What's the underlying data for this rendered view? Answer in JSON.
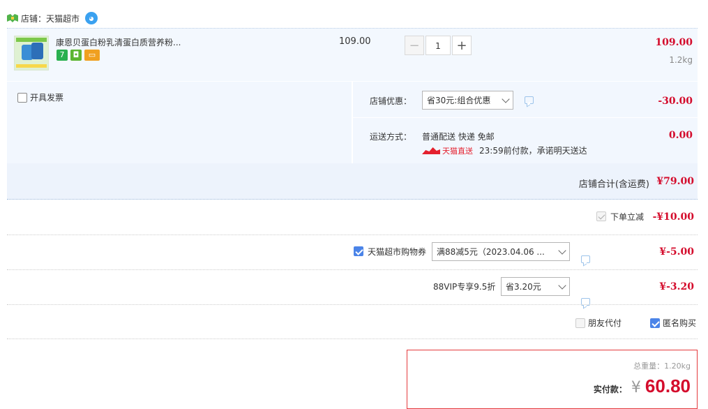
{
  "shop": {
    "label": "店铺：天猫超市"
  },
  "item": {
    "name": "康恩贝蛋白粉乳清蛋白质营养粉...",
    "badges": [
      "7",
      "",
      ""
    ],
    "unit_price": "109.00",
    "quantity": "1",
    "total": "109.00",
    "weight": "1.2kg",
    "minus_label": "−",
    "plus_label": "+"
  },
  "invoice": {
    "label": "开具发票"
  },
  "shop_discount": {
    "label": "店铺优惠：",
    "selected": "省30元:组合优惠",
    "amount": "-30.00"
  },
  "shipping": {
    "label": "运送方式：",
    "method": "普通配送 快递 免邮",
    "amount": "0.00",
    "tmall_direct": "天猫直送",
    "promise": "23:59前付款，承诺明天送达"
  },
  "shop_subtotal": {
    "label": "店铺合计(含运费)",
    "amount": "¥79.00"
  },
  "order_discount": {
    "label": "下单立减",
    "amount": "-¥10.00"
  },
  "coupon": {
    "label": "天猫超市购物券",
    "selected": "满88减5元（2023.04.06 ...",
    "amount": "¥-5.00"
  },
  "vip": {
    "label": "88VIP专享9.5折",
    "selected": "省3.20元",
    "amount": "¥-3.20"
  },
  "options": {
    "friend_pay": "朋友代付",
    "anonymous": "匿名购买"
  },
  "payment": {
    "weight_label": "总重量：",
    "weight_value": "1.20kg",
    "pay_label": "实付款：",
    "currency": "¥",
    "amount": "60.80"
  },
  "colors": {
    "price_red": "#d40c2c",
    "checkbox_blue": "#4b84e8",
    "row_bg": "#f2f7fe"
  }
}
